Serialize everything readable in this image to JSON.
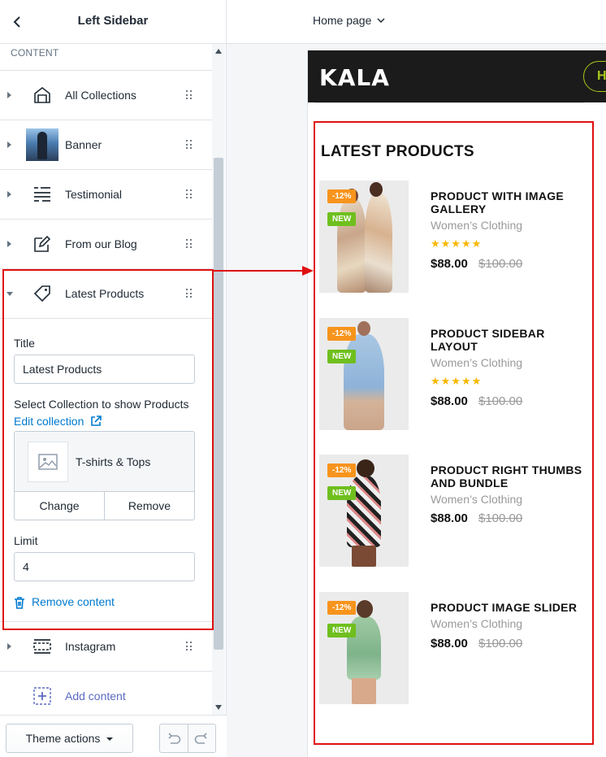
{
  "sidebar": {
    "title": "Left Sidebar",
    "section_label": "CONTENT",
    "items": [
      {
        "label": "All Collections",
        "icon": "collections-icon"
      },
      {
        "label": "Banner",
        "icon": "banner-thumbnail"
      },
      {
        "label": "Testimonial",
        "icon": "testimonial-icon"
      },
      {
        "label": "From our Blog",
        "icon": "blog-edit-icon"
      },
      {
        "label": "Latest Products",
        "icon": "tag-icon",
        "expanded": true
      },
      {
        "label": "Instagram",
        "icon": "instagram-block-icon"
      }
    ],
    "latest_products": {
      "title_label": "Title",
      "title_value": "Latest Products",
      "collection_label": "Select Collection to show Products",
      "edit_collection_link": "Edit collection",
      "collection_name": "T-shirts & Tops",
      "change_button": "Change",
      "remove_button": "Remove",
      "limit_label": "Limit",
      "limit_value": "4",
      "remove_content_link": "Remove content"
    },
    "add_content": "Add content",
    "footer": {
      "theme_actions": "Theme actions"
    }
  },
  "topbar": {
    "page_select": "Home page"
  },
  "storefront": {
    "logo": "KALA",
    "nav_partial": "H",
    "section_title": "LATEST PRODUCTS",
    "products": [
      {
        "name": "PRODUCT WITH IMAGE GALLERY",
        "category": "Women’s Clothing",
        "stars": "★★★★★",
        "price": "$88.00",
        "old_price": "$100.00",
        "sale_badge": "-12%",
        "new_badge": "NEW"
      },
      {
        "name": "PRODUCT SIDEBAR LAYOUT",
        "category": "Women’s Clothing",
        "stars": "★★★★★",
        "price": "$88.00",
        "old_price": "$100.00",
        "sale_badge": "-12%",
        "new_badge": "NEW"
      },
      {
        "name": "PRODUCT RIGHT THUMBS AND BUNDLE",
        "category": "Women’s Clothing",
        "stars": "",
        "price": "$88.00",
        "old_price": "$100.00",
        "sale_badge": "-12%",
        "new_badge": "NEW"
      },
      {
        "name": "PRODUCT IMAGE SLIDER",
        "category": "Women’s Clothing",
        "stars": "",
        "price": "$88.00",
        "old_price": "$100.00",
        "sale_badge": "-12%",
        "new_badge": "NEW"
      }
    ]
  },
  "colors": {
    "annotation": "#e01010",
    "link": "#007ace",
    "sale_badge": "#f7941d",
    "new_badge": "#6fbf1e",
    "star": "#f8b700",
    "nav_accent": "#a8c91a"
  }
}
